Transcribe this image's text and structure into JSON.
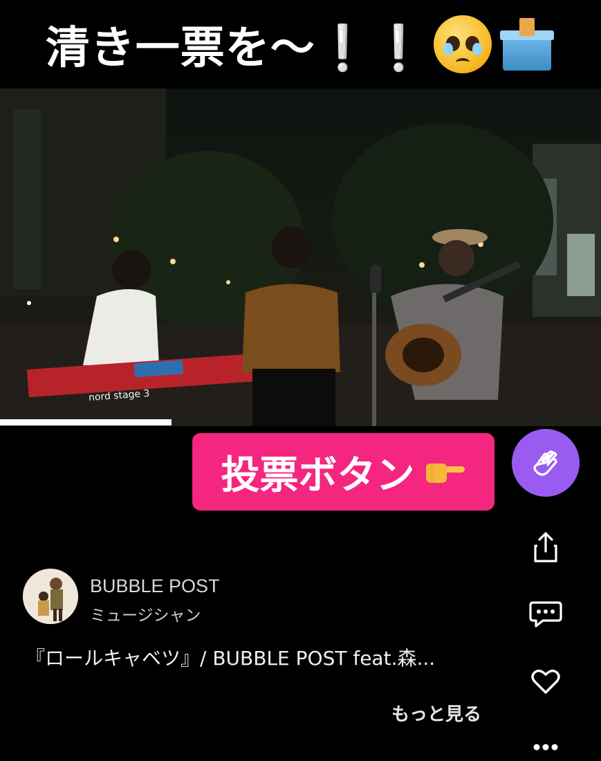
{
  "caption": {
    "text": "清き一票を〜❕❕"
  },
  "emojis": {
    "face": "pleading-face-icon",
    "ballot": "ballot-box-icon"
  },
  "video": {
    "progress_fraction": 0.285,
    "keyboard_brand": "nord stage 3"
  },
  "vote_banner": {
    "label": "投票ボタン",
    "icon": "pointing-right-icon",
    "color": "#f5267f"
  },
  "actions": {
    "clap_color": "#9a5cf0",
    "icons": [
      "clap-icon",
      "share-icon",
      "comment-icon",
      "heart-icon",
      "more-icon"
    ]
  },
  "channel": {
    "name": "BUBBLE POST",
    "category": "ミュージシャン"
  },
  "video_title": "『ロールキャベツ』/ BUBBLE POST feat.森...",
  "more_label": "もっと見る"
}
